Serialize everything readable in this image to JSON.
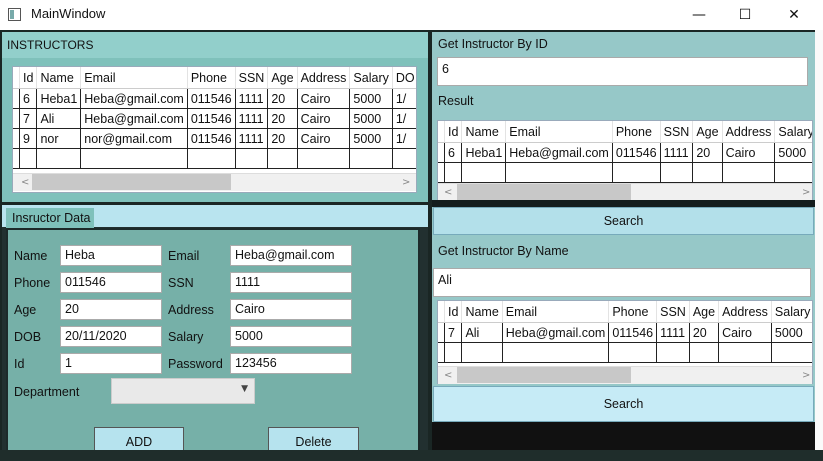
{
  "window": {
    "title": "MainWindow",
    "minimize_glyph": "—",
    "maximize_glyph": "☐",
    "close_glyph": "✕"
  },
  "instructors_grid": {
    "tab_label": "INSTRUCTORS",
    "columns": [
      "Id",
      "Name",
      "Email",
      "Phone",
      "SSN",
      "Age",
      "Address",
      "Salary",
      "DO"
    ],
    "rows": [
      [
        "6",
        "Heba1",
        "Heba@gmail.com",
        "011546",
        "1111",
        "20",
        "Cairo",
        "5000",
        "1/"
      ],
      [
        "7",
        "Ali",
        "Heba@gmail.com",
        "011546",
        "1111",
        "20",
        "Cairo",
        "5000",
        "1/"
      ],
      [
        "9",
        "nor",
        "nor@gmail.com",
        "011546",
        "1111",
        "20",
        "Cairo",
        "5000",
        "1/"
      ]
    ]
  },
  "instructor_data": {
    "tab_label": "Insructor Data",
    "fields": {
      "name": {
        "label": "Name",
        "value": "Heba"
      },
      "phone": {
        "label": "Phone",
        "value": "011546"
      },
      "age": {
        "label": "Age",
        "value": "20"
      },
      "dob": {
        "label": "DOB",
        "value": "20/11/2020"
      },
      "id": {
        "label": "Id",
        "value": "1"
      },
      "email": {
        "label": "Email",
        "value": "Heba@gmail.com"
      },
      "ssn": {
        "label": "SSN",
        "value": "1111"
      },
      "address": {
        "label": "Address",
        "value": "Cairo"
      },
      "salary": {
        "label": "Salary",
        "value": "5000"
      },
      "password": {
        "label": "Password",
        "value": "123456"
      }
    },
    "department_label": "Department",
    "department_value": "",
    "add_label": "ADD",
    "delete_label": "Delete"
  },
  "by_id": {
    "label": "Get Instructor By ID",
    "input_value": "6",
    "result_label": "Result",
    "columns": [
      "Id",
      "Name",
      "Email",
      "Phone",
      "SSN",
      "Age",
      "Address",
      "Salary"
    ],
    "rows": [
      [
        "6",
        "Heba1",
        "Heba@gmail.com",
        "011546",
        "1111",
        "20",
        "Cairo",
        "5000"
      ]
    ],
    "search_label": "Search"
  },
  "by_name": {
    "label": "Get Instructor By Name",
    "input_value": "Ali",
    "columns": [
      "Id",
      "Name",
      "Email",
      "Phone",
      "SSN",
      "Age",
      "Address",
      "Salary"
    ],
    "rows": [
      [
        "7",
        "Ali",
        "Heba@gmail.com",
        "011546",
        "1111",
        "20",
        "Cairo",
        "5000"
      ]
    ],
    "search_label": "Search"
  },
  "colors": {
    "teal": "#7fc1bb",
    "light_blue": "#b6e3ee",
    "dark": "#1a2624"
  }
}
